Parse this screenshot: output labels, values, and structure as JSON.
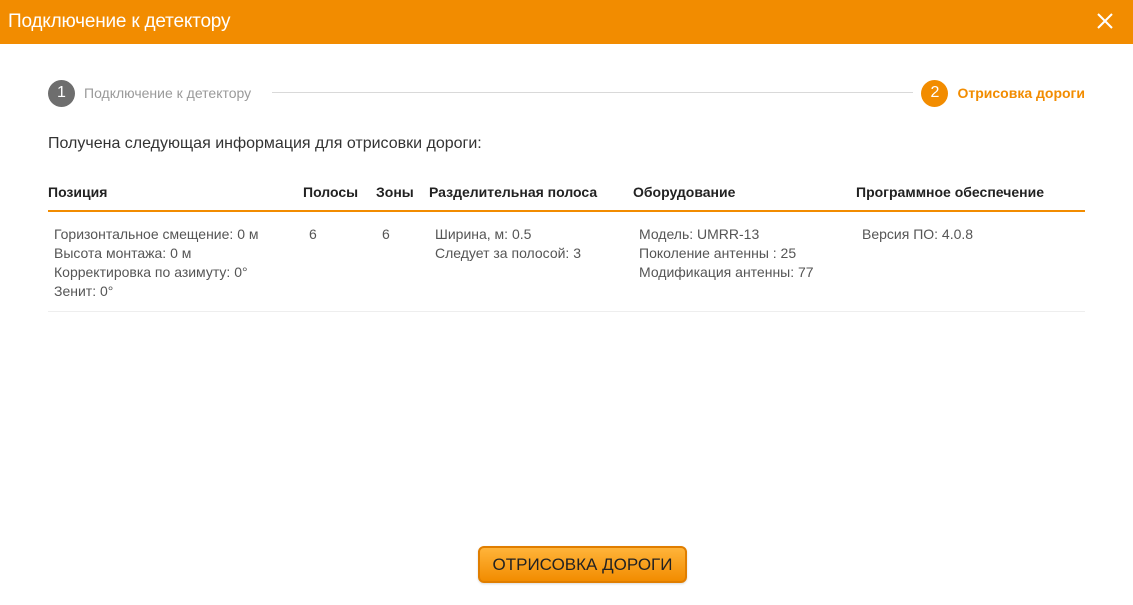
{
  "window": {
    "title": "Подключение к детектору",
    "close_icon": "close-icon"
  },
  "stepper": {
    "steps": [
      {
        "number": "1",
        "label": "Подключение к детектору",
        "state": "done"
      },
      {
        "number": "2",
        "label": "Отрисовка дороги",
        "state": "active"
      }
    ]
  },
  "intro_text": "Получена следующая информация для отрисовки дороги:",
  "table": {
    "headers": {
      "position": "Позиция",
      "lanes": "Полосы",
      "zones": "Зоны",
      "divider": "Разделительная полоса",
      "equipment": "Оборудование",
      "software": "Программное обеспечение"
    },
    "row": {
      "position": [
        "Горизонтальное смещение: 0 м",
        "Высота монтажа: 0 м",
        "Корректировка по азимуту: 0°",
        "Зенит: 0°"
      ],
      "lanes": "6",
      "zones": "6",
      "divider": [
        "Ширина, м: 0.5",
        "Следует за полосой: 3"
      ],
      "equipment": [
        "Модель: UMRR-13",
        "Поколение антенны : 25",
        "Модификация антенны: 77"
      ],
      "software": [
        "Версия ПО: 4.0.8"
      ]
    }
  },
  "actions": {
    "draw_road_label": "ОТРИСОВКА ДОРОГИ"
  },
  "colors": {
    "accent": "#f28c00",
    "step_done": "#6e6e6e"
  }
}
